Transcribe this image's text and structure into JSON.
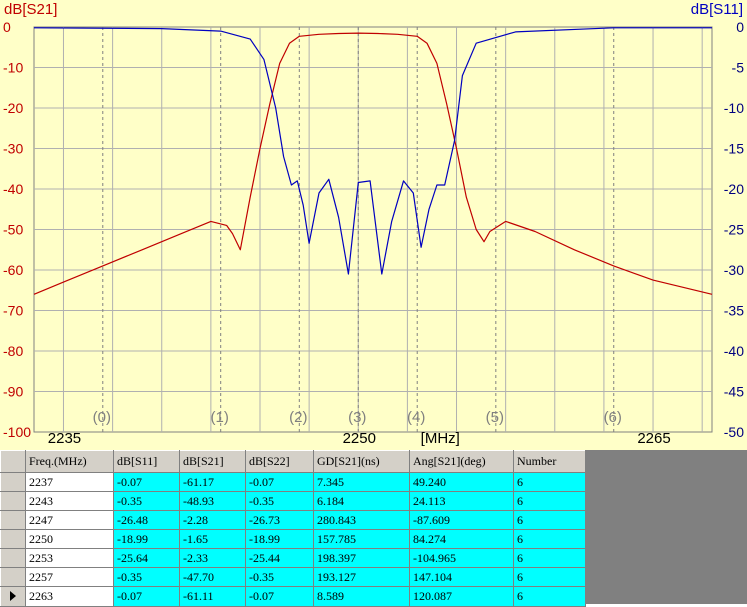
{
  "chart_data": {
    "type": "line",
    "ylabel_left": "dB[S21]",
    "ylabel_right": "dB[S11]",
    "xlabel": "[MHz]",
    "xlim": [
      2233.5,
      2268
    ],
    "ylim_left": [
      -100,
      0
    ],
    "ylim_right": [
      -50,
      0
    ],
    "yticks_left": [
      0,
      -10,
      -20,
      -30,
      -40,
      -50,
      -60,
      -70,
      -80,
      -90,
      -100
    ],
    "yticks_right": [
      0,
      -5,
      -10,
      -15,
      -20,
      -25,
      -30,
      -35,
      -40,
      -45,
      -50
    ],
    "xticks": [
      2235,
      2250,
      2265
    ],
    "grid_x": [
      2235,
      2237.5,
      2240,
      2242.5,
      2245,
      2247.5,
      2250,
      2252.5,
      2255,
      2257.5,
      2260,
      2262.5,
      2265,
      2267.5
    ],
    "grid_y": [
      -10,
      -20,
      -30,
      -40,
      -50,
      -60,
      -70,
      -80,
      -90
    ],
    "markers": [
      {
        "label": "(0)",
        "x": 2237
      },
      {
        "label": "(1)",
        "x": 2243
      },
      {
        "label": "(2)",
        "x": 2247
      },
      {
        "label": "(3)",
        "x": 2250
      },
      {
        "label": "(4)",
        "x": 2253
      },
      {
        "label": "(5)",
        "x": 2257
      },
      {
        "label": "(6)",
        "x": 2263
      }
    ],
    "series": [
      {
        "name": "dB[S21]",
        "axis": "left",
        "color": "#c00000",
        "x": [
          2233.5,
          2235,
          2237,
          2239,
          2241,
          2242.5,
          2243.3,
          2243.6,
          2244.0,
          2244.5,
          2245,
          2245.5,
          2246.0,
          2246.5,
          2247,
          2248,
          2249,
          2250,
          2251,
          2252,
          2253,
          2253.5,
          2254.0,
          2254.5,
          2255,
          2255.5,
          2256.0,
          2256.4,
          2256.7,
          2257.5,
          2259,
          2261,
          2263,
          2265,
          2268
        ],
        "values": [
          -66,
          -63,
          -59,
          -55,
          -51,
          -48,
          -49,
          -51,
          -55,
          -42,
          -30,
          -19,
          -9,
          -4,
          -2.3,
          -1.8,
          -1.6,
          -1.5,
          -1.6,
          -1.8,
          -2.3,
          -4,
          -9,
          -19,
          -30,
          -42,
          -50,
          -53,
          -50.5,
          -48,
          -50.5,
          -55,
          -59,
          -62.5,
          -66
        ]
      },
      {
        "name": "dB[S11]",
        "axis": "right",
        "color": "#0000c0",
        "x": [
          2233.5,
          2240,
          2243,
          2244.5,
          2245.2,
          2245.8,
          2246.2,
          2246.6,
          2246.9,
          2247.2,
          2247.5,
          2248.0,
          2248.5,
          2249.0,
          2249.5,
          2250.0,
          2250.6,
          2251.2,
          2251.7,
          2252.3,
          2252.8,
          2253.2,
          2253.6,
          2254.0,
          2254.4,
          2254.9,
          2255.3,
          2256.0,
          2258,
          2263,
          2268
        ],
        "values": [
          -0.1,
          -0.2,
          -0.5,
          -1.5,
          -4,
          -10,
          -16,
          -19.5,
          -19,
          -22,
          -26.7,
          -20.5,
          -18.8,
          -23.5,
          -30.5,
          -19.2,
          -19.0,
          -30.5,
          -24.0,
          -19.0,
          -20.5,
          -27.2,
          -22.5,
          -19.5,
          -19.5,
          -14,
          -6,
          -2,
          -0.6,
          -0.1,
          -0.1
        ]
      }
    ]
  },
  "table": {
    "headers": [
      "Freq.(MHz)",
      "dB[S11]",
      "dB[S21]",
      "dB[S22]",
      "GD[S21](ns)",
      "Ang[S21](deg)",
      "Number"
    ],
    "rows": [
      [
        "2237",
        "-0.07",
        "-61.17",
        "-0.07",
        "7.345",
        "49.240",
        "6"
      ],
      [
        "2243",
        "-0.35",
        "-48.93",
        "-0.35",
        "6.184",
        "24.113",
        "6"
      ],
      [
        "2247",
        "-26.48",
        "-2.28",
        "-26.73",
        "280.843",
        "-87.609",
        "6"
      ],
      [
        "2250",
        "-18.99",
        "-1.65",
        "-18.99",
        "157.785",
        "84.274",
        "6"
      ],
      [
        "2253",
        "-25.64",
        "-2.33",
        "-25.44",
        "198.397",
        "-104.965",
        "6"
      ],
      [
        "2257",
        "-0.35",
        "-47.70",
        "-0.35",
        "193.127",
        "147.104",
        "6"
      ],
      [
        "2263",
        "-0.07",
        "-61.11",
        "-0.07",
        "8.589",
        "120.087",
        "6"
      ]
    ],
    "selected_row": 6
  }
}
